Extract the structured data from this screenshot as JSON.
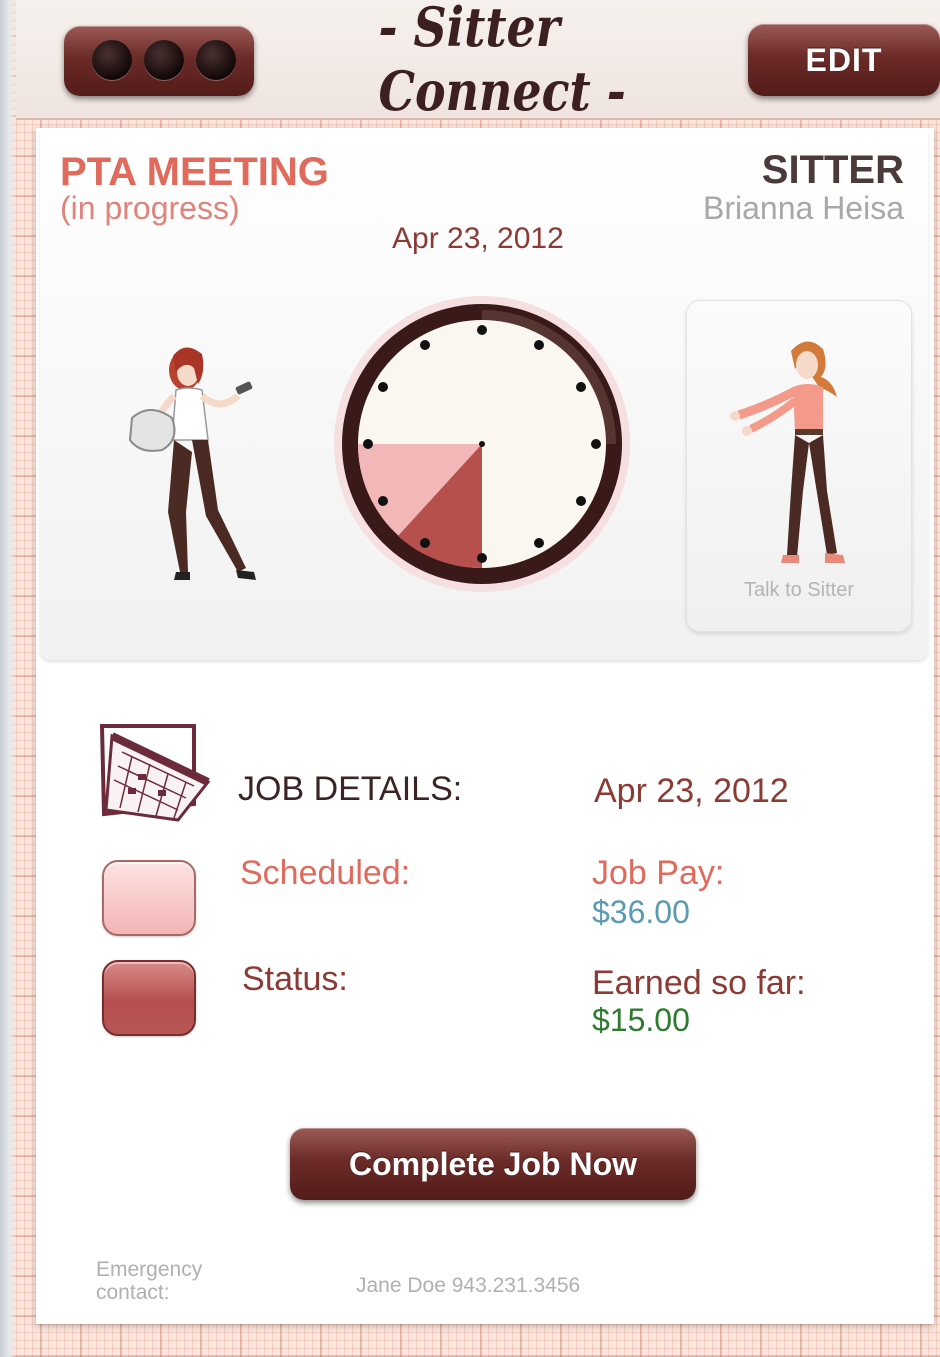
{
  "app": {
    "title": "- Sitter Connect -"
  },
  "header": {
    "menu_icon": "three-dots-menu",
    "edit_label": "EDIT"
  },
  "event": {
    "title": "PTA MEETING",
    "status": "(in progress)",
    "date": "Apr 23, 2012"
  },
  "sitter": {
    "heading": "SITTER",
    "name": "Brianna Heisa",
    "talk_label": "Talk to Sitter"
  },
  "clock": {
    "scheduled_color": "#f2b8b8",
    "elapsed_color": "#b5504d",
    "face_color": "#faf7f0",
    "rim_color": "#3a1a18"
  },
  "details": {
    "heading": "JOB DETAILS:",
    "date": "Apr 23, 2012",
    "scheduled_label": "Scheduled:",
    "status_label": "Status:",
    "pay_label": "Job Pay:",
    "pay_value": "$36.00",
    "earned_label": "Earned so far:",
    "earned_value": "$15.00",
    "scheduled_color": "#f5c8c8",
    "status_color": "#b65454",
    "calendar_icon": "calendar-icon"
  },
  "actions": {
    "complete_label": "Complete Job Now"
  },
  "emergency": {
    "label": "Emergency contact:",
    "value": "Jane Doe 943.231.3456"
  }
}
